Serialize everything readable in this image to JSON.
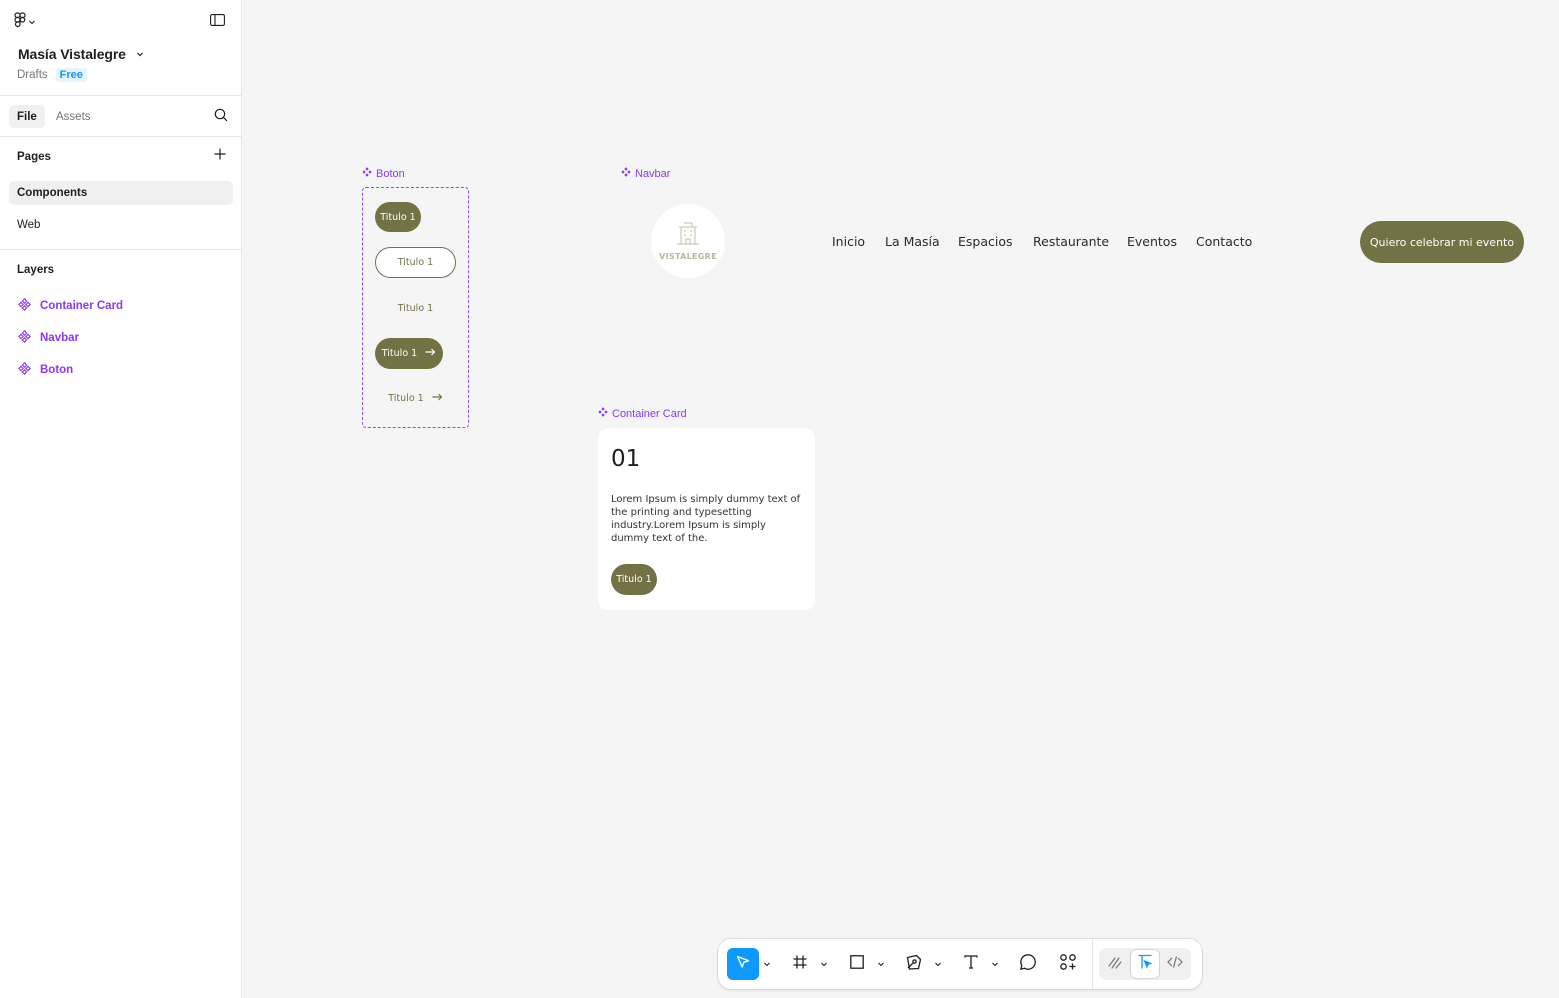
{
  "file": {
    "title": "Masía Vistalegre",
    "location": "Drafts",
    "plan": "Free"
  },
  "left_tabs": {
    "file": "File",
    "assets": "Assets"
  },
  "pages": {
    "heading": "Pages",
    "items": [
      "Components",
      "Web"
    ],
    "selected": "Components"
  },
  "layers": {
    "heading": "Layers",
    "items": [
      "Container Card",
      "Navbar",
      "Boton"
    ]
  },
  "canvas": {
    "boton_frame": {
      "label": "Boton",
      "buttons": [
        "Titulo 1",
        "Titulo 1",
        "Titulo 1",
        "Titulo 1",
        "Titulo 1"
      ]
    },
    "navbar_frame": {
      "label": "Navbar",
      "logo_text": "VISTALEGRE",
      "links": [
        "Inicio",
        "La Masía",
        "Espacios",
        "Restaurante",
        "Eventos",
        "Contacto"
      ],
      "cta": "Quiero celebrar mi evento"
    },
    "card_frame": {
      "label": "Container Card",
      "number": "01",
      "body": "Lorem Ipsum is simply dummy text of the printing and typesetting industry.Lorem Ipsum is simply dummy text of the.",
      "button": "Titulo 1"
    }
  },
  "toolbar": {
    "tools": [
      "move-tool",
      "frame-tool",
      "rectangle-tool",
      "pen-tool",
      "text-tool",
      "comment-tool",
      "actions-tool"
    ],
    "modes": [
      "draw-mode",
      "design-mode",
      "dev-mode"
    ],
    "active_tool": "move-tool",
    "active_mode": "design-mode"
  },
  "colors": {
    "accent": "#0d99ff",
    "component": "#8a38f5",
    "brand_olive": "#737245",
    "canvas": "#f5f5f5"
  }
}
